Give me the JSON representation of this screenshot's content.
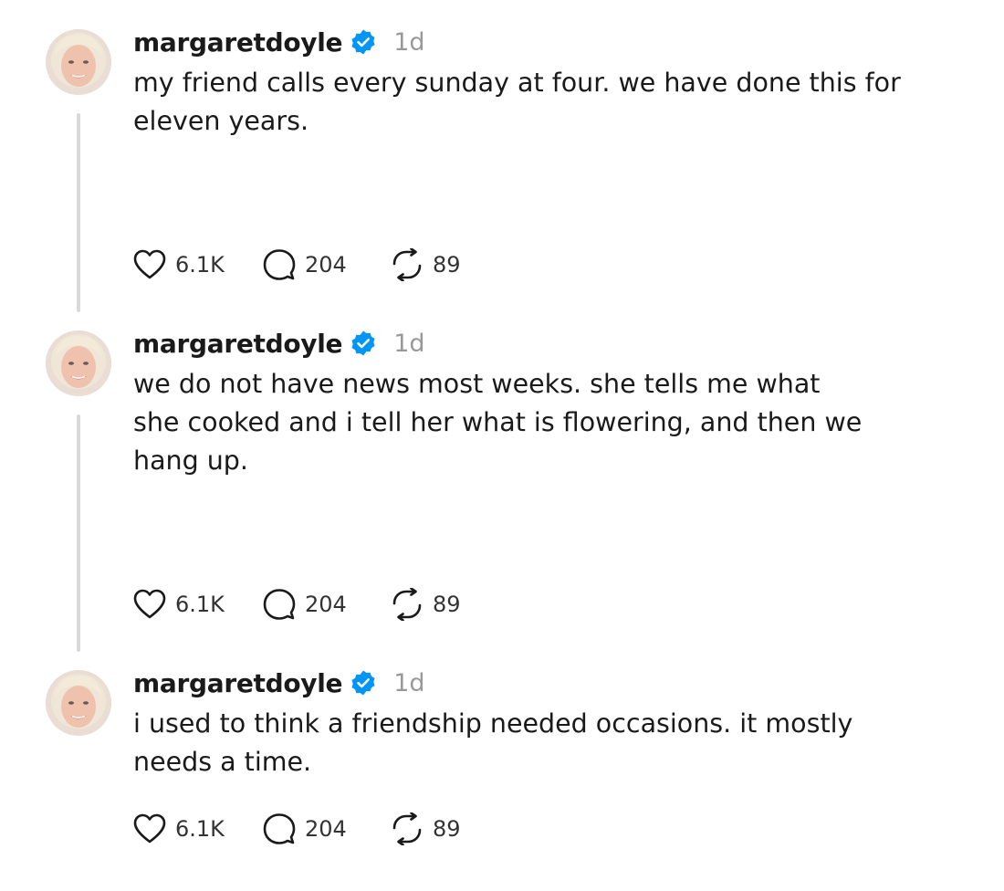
{
  "posts": [
    {
      "username": "margaretdoyle",
      "time": "1d",
      "lines": [
        "my friend calls every sunday at four. we have done this for",
        "eleven years."
      ],
      "likes": "6.1K",
      "replies": "204",
      "reposts": "89"
    },
    {
      "username": "margaretdoyle",
      "time": "1d",
      "lines": [
        "we do not have news most weeks. she tells me what",
        "she cooked and i tell her what is flowering, and then we",
        "hang up."
      ],
      "likes": "6.1K",
      "replies": "204",
      "reposts": "89"
    },
    {
      "username": "margaretdoyle",
      "time": "1d",
      "lines": [
        "i used to think a friendship needed occasions. it mostly",
        "needs a time."
      ],
      "likes": "6.1K",
      "replies": "204",
      "reposts": "89"
    }
  ],
  "colors": {
    "verified": "#0095f6",
    "thread_line": "#d9d9d9",
    "timestamp": "#999999",
    "text": "#1a1a1a"
  },
  "icons": {
    "verified": "verified-badge-icon",
    "like": "heart-icon",
    "reply": "speech-bubble-icon",
    "repost": "repost-arrows-icon"
  }
}
